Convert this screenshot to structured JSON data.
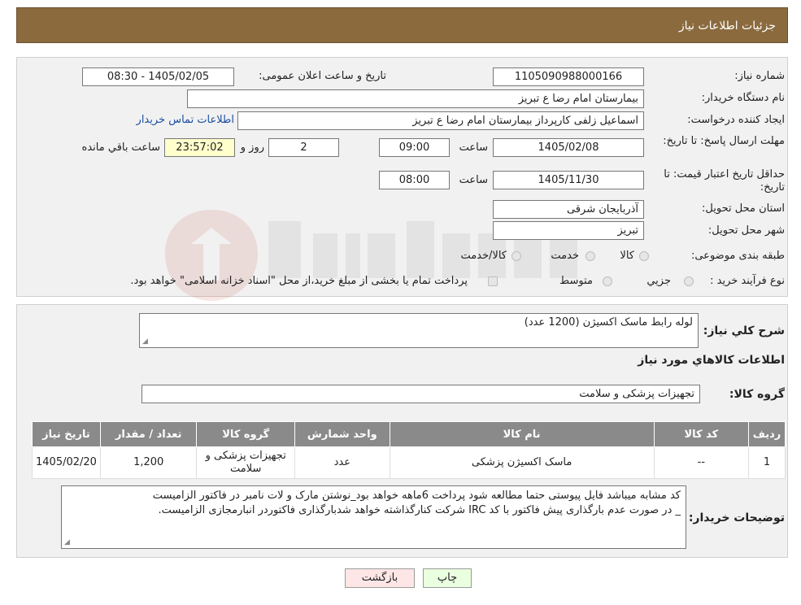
{
  "page": {
    "title": "جزئیات اطلاعات نیاز"
  },
  "form": {
    "need_number": {
      "label": "شماره نیاز:",
      "value": "1105090988000166"
    },
    "announce_datetime": {
      "label": "تاریخ و ساعت اعلان عمومی:",
      "value": "1405/02/05 - 08:30"
    },
    "buyer_org": {
      "label": "نام دستگاه خریدار:",
      "value": "بیمارستان امام رضا  ع  تبریز"
    },
    "requester": {
      "label": "ایجاد کننده درخواست:",
      "value": "اسماعیل زلفی کارپرداز بیمارستان امام رضا  ع  تبریز"
    },
    "contact_link": "اطلاعات تماس خریدار",
    "deadline": {
      "label": "مهلت ارسال پاسخ: تا تاریخ:",
      "date": "1405/02/08",
      "time_label": "ساعت",
      "time": "09:00",
      "days": "2",
      "days_label": "روز و",
      "remaining": "23:57:02",
      "remaining_label": "ساعت باقي مانده"
    },
    "price_validity": {
      "label": "حداقل تاریخ اعتبار قیمت: تا تاریخ:",
      "date": "1405/11/30",
      "time_label": "ساعت",
      "time": "08:00"
    },
    "province": {
      "label": "استان محل تحویل:",
      "value": "آذربایجان شرقی"
    },
    "city": {
      "label": "شهر محل تحویل:",
      "value": "تبریز"
    },
    "category": {
      "label": "طبقه بندی موضوعی:",
      "options": [
        "کالا",
        "خدمت",
        "کالا/خدمت"
      ]
    },
    "process": {
      "label": "نوع فرآیند خرید :",
      "options": [
        "جزيي",
        "متوسط"
      ],
      "note": "پرداخت تمام یا بخشی از مبلغ خرید،از محل \"اسناد خزانه اسلامی\" خواهد بود."
    }
  },
  "summary": {
    "label": "شرح کلي نياز:",
    "value": "لوله رابط ماسک اکسیژن (1200 عدد)"
  },
  "goods_title": "اطلاعات کالاهاي مورد نياز",
  "goods_group": {
    "label": "گروه کالا:",
    "value": "تجهیزات پزشکی و سلامت"
  },
  "table": {
    "headers": [
      "رديف",
      "کد کالا",
      "نام کالا",
      "واحد شمارش",
      "گروه کالا",
      "تعداد / مقدار",
      "تاريخ نياز"
    ],
    "rows": [
      [
        "1",
        "--",
        "ماسک اکسیژن پزشکی",
        "عدد",
        "تجهیزات پزشکی و سلامت",
        "1,200",
        "1405/02/20"
      ]
    ]
  },
  "buyer_notes": {
    "label": "توضيحات خريدار:",
    "line1": "کد مشابه میباشد فایل پیوستی حتما مطالعه شود  پرداخت 6ماهه خواهد بود_نوشتن مارک و لات نامبر در فاکتور الزامیست",
    "line2": "_  در صورت عدم بارگذاری پیش فاکتور با کد IRC  شرکت کنارگذاشته خواهد شدبارگذاری فاکتوردر انبارمجازی الزامیست."
  },
  "buttons": {
    "print": "چاپ",
    "back": "بازگشت"
  },
  "colors": {
    "header": "#8b6a3e",
    "table_header": "#8a8a8a",
    "print_btn": "#eaffe0",
    "back_btn": "#ffe6e6"
  }
}
